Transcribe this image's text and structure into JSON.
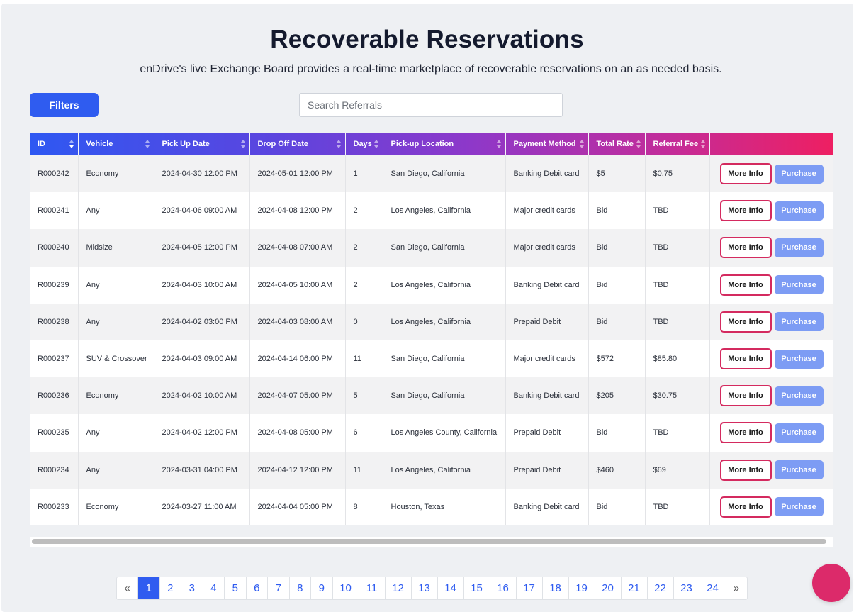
{
  "header": {
    "title": "Recoverable Reservations",
    "subtitle": "enDrive's live Exchange Board provides a real-time marketplace of recoverable reservations on an as needed basis."
  },
  "toolbar": {
    "filters_label": "Filters",
    "search_placeholder": "Search Referrals"
  },
  "table": {
    "columns": [
      "ID",
      "Vehicle",
      "Pick Up Date",
      "Drop Off Date",
      "Days",
      "Pick-up Location",
      "Payment Method",
      "Total Rate",
      "Referral Fee",
      ""
    ],
    "more_info_label": "More Info",
    "purchase_label": "Purchase",
    "rows": [
      {
        "id": "R000242",
        "vehicle": "Economy",
        "pickup": "2024-04-30 12:00 PM",
        "dropoff": "2024-05-01 12:00 PM",
        "days": "1",
        "location": "San Diego, California",
        "payment": "Banking Debit card",
        "rate": "$5",
        "fee": "$0.75"
      },
      {
        "id": "R000241",
        "vehicle": "Any",
        "pickup": "2024-04-06 09:00 AM",
        "dropoff": "2024-04-08 12:00 PM",
        "days": "2",
        "location": "Los Angeles, California",
        "payment": "Major credit cards",
        "rate": "Bid",
        "fee": "TBD"
      },
      {
        "id": "R000240",
        "vehicle": "Midsize",
        "pickup": "2024-04-05 12:00 PM",
        "dropoff": "2024-04-08 07:00 AM",
        "days": "2",
        "location": "San Diego, California",
        "payment": "Major credit cards",
        "rate": "Bid",
        "fee": "TBD"
      },
      {
        "id": "R000239",
        "vehicle": "Any",
        "pickup": "2024-04-03 10:00 AM",
        "dropoff": "2024-04-05 10:00 AM",
        "days": "2",
        "location": "Los Angeles, California",
        "payment": "Banking Debit card",
        "rate": "Bid",
        "fee": "TBD"
      },
      {
        "id": "R000238",
        "vehicle": "Any",
        "pickup": "2024-04-02 03:00 PM",
        "dropoff": "2024-04-03 08:00 AM",
        "days": "0",
        "location": "Los Angeles, California",
        "payment": "Prepaid Debit",
        "rate": "Bid",
        "fee": "TBD"
      },
      {
        "id": "R000237",
        "vehicle": "SUV & Crossover",
        "pickup": "2024-04-03 09:00 AM",
        "dropoff": "2024-04-14 06:00 PM",
        "days": "11",
        "location": "San Diego, California",
        "payment": "Major credit cards",
        "rate": "$572",
        "fee": "$85.80"
      },
      {
        "id": "R000236",
        "vehicle": "Economy",
        "pickup": "2024-04-02 10:00 AM",
        "dropoff": "2024-04-07 05:00 PM",
        "days": "5",
        "location": "San Diego, California",
        "payment": "Banking Debit card",
        "rate": "$205",
        "fee": "$30.75"
      },
      {
        "id": "R000235",
        "vehicle": "Any",
        "pickup": "2024-04-02 12:00 PM",
        "dropoff": "2024-04-08 05:00 PM",
        "days": "6",
        "location": "Los Angeles County, California",
        "payment": "Prepaid Debit",
        "rate": "Bid",
        "fee": "TBD"
      },
      {
        "id": "R000234",
        "vehicle": "Any",
        "pickup": "2024-03-31 04:00 PM",
        "dropoff": "2024-04-12 12:00 PM",
        "days": "11",
        "location": "Los Angeles, California",
        "payment": "Prepaid Debit",
        "rate": "$460",
        "fee": "$69"
      },
      {
        "id": "R000233",
        "vehicle": "Economy",
        "pickup": "2024-03-27 11:00 AM",
        "dropoff": "2024-04-04 05:00 PM",
        "days": "8",
        "location": "Houston, Texas",
        "payment": "Banking Debit card",
        "rate": "Bid",
        "fee": "TBD"
      }
    ]
  },
  "pagination": {
    "prev_label": "«",
    "next_label": "»",
    "pages": [
      "1",
      "2",
      "3",
      "4",
      "5",
      "6",
      "7",
      "8",
      "9",
      "10",
      "11",
      "12",
      "13",
      "14",
      "15",
      "16",
      "17",
      "18",
      "19",
      "20",
      "21",
      "22",
      "23",
      "24"
    ],
    "current": "1"
  },
  "colors": {
    "accent": "#2f5cf0",
    "brand_pink": "#dc2a6a",
    "purchase": "#7d9cf4"
  },
  "icons": {
    "sort": "sort-icon",
    "chat": "chat-bubble-icon"
  }
}
